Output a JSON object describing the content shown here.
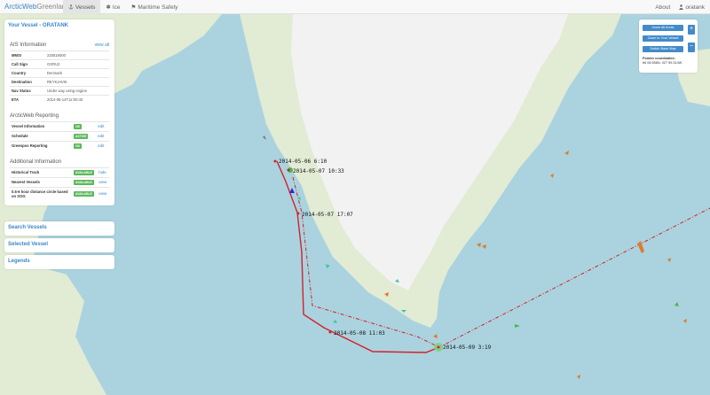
{
  "navbar": {
    "brand_a": "ArcticWeb",
    "brand_b": "Greenland",
    "tabs": [
      "Vessels",
      "Ice",
      "Maritime Safety"
    ],
    "about": "About",
    "user": "oratank"
  },
  "panel": {
    "title": "Your Vessel - ORATANK",
    "ais": {
      "heading": "AIS Information",
      "link": "view all",
      "rows": [
        {
          "k": "MMSI",
          "v": "220516000"
        },
        {
          "k": "Call Sign",
          "v": "OXRU2"
        },
        {
          "k": "Country",
          "v": "Denmark"
        },
        {
          "k": "Destination",
          "v": "REYKJAVIK"
        },
        {
          "k": "Nav Status",
          "v": "Under way using engine"
        },
        {
          "k": "ETA",
          "v": "2014-05-14T12:00:40"
        }
      ]
    },
    "reporting": {
      "heading": "ArcticWeb Reporting",
      "rows": [
        {
          "k": "Vessel Information",
          "badge": "OK",
          "action": "edit"
        },
        {
          "k": "Schedule",
          "badge": "ACTIVE",
          "action": "edit"
        },
        {
          "k": "Greenpos Reporting",
          "badge": "OK",
          "action": "edit"
        }
      ]
    },
    "additional": {
      "heading": "Additional Information",
      "rows": [
        {
          "k": "Historical Track",
          "badge": "AVAILABLE",
          "action": "hide"
        },
        {
          "k": "Nearest Vessels",
          "badge": "AVAILABLE",
          "action": "view"
        },
        {
          "k": "0.6-6 hour distance circle based on SOG",
          "badge": "AVAILABLE",
          "action": "view"
        }
      ]
    }
  },
  "sections": [
    "Search Vessels",
    "Selected Vessel",
    "Legends"
  ],
  "controls": {
    "zoom_all": "Zoom All Arctic",
    "zoom_vessel": "Zoom to Your Vessel",
    "switch_map": "Switch Base Map",
    "zoom_in": "+",
    "zoom_out": "−",
    "coords_label": "Pointer coordinates:",
    "coords_value": "66 06.558N, 027 59.314W"
  },
  "map_labels": [
    "2014-05-06 6:10",
    "2014-05-07 10:33",
    "2014-05-07 17:07",
    "2014-05-08 11:03",
    "2014-05-09 3:19"
  ],
  "colors": {
    "accent": "#3a87c8",
    "track": "#d4202a",
    "badge": "#5cb85c",
    "land": "#e2ebd4",
    "ice": "#f2f2f2",
    "sea": "#aad3df"
  }
}
